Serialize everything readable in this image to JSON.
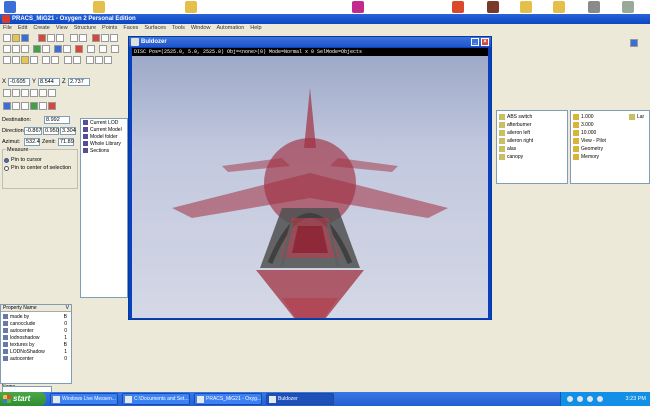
{
  "app": {
    "title": "PRACS_MiG21 - Oxygen 2 Personal Edition",
    "menu": [
      "File",
      "Edit",
      "Create",
      "View",
      "Structure",
      "Points",
      "Faces",
      "Surfaces",
      "Tools",
      "Window",
      "Automation",
      "Help"
    ]
  },
  "coords": {
    "x_label": "X",
    "x_value": "-0.605",
    "y_label": "Y",
    "y_value": "8.544",
    "z_label": "Z",
    "z_value": "2.737"
  },
  "left_panel": {
    "destination_label": "Destination:",
    "destination_value": "8.992",
    "direction_label": "Direction:",
    "direction_values": [
      "-0.867",
      "0.950",
      "3.304"
    ],
    "azimuth_label": "Azimut:",
    "azimuth_value": "532.4",
    "zenith_label": "Zenit:",
    "zenith_value": "71.89",
    "measure_label": "Measure",
    "options": [
      "Pin to cursor",
      "Pin to center of selection"
    ]
  },
  "tree": {
    "items": [
      "Current LOD",
      "Current Model",
      "Model folder",
      "Whole Library",
      "Sections"
    ]
  },
  "viewport": {
    "window_title": "Buldozer",
    "status": "DISC Pos=(2525.0, 5.0, 2525.0) Obj=<none>(0) Mode=Normal x 0 SelMode=Objects"
  },
  "list_selections": {
    "items": [
      "ABS switch",
      "afterburner",
      "aileron left",
      "aileron right",
      "alas",
      "canopy"
    ]
  },
  "list_values": {
    "items": [
      "1.000",
      "3.000",
      "10.000",
      "View - Pilot",
      "Geometry",
      "Memory"
    ],
    "extra_label": "Lar"
  },
  "properties": {
    "header_name": "Property Name",
    "header_value": "V",
    "rows": [
      {
        "name": "made by",
        "value": "B"
      },
      {
        "name": "canocclude",
        "value": "0"
      },
      {
        "name": "autocenter",
        "value": "0"
      },
      {
        "name": "lodnoshadow",
        "value": "1"
      },
      {
        "name": "textures by",
        "value": "B"
      },
      {
        "name": "LODNoShadow",
        "value": "1"
      },
      {
        "name": "autocenter",
        "value": "0"
      }
    ],
    "name_label": "Name"
  },
  "taskbar": {
    "start_label": "start",
    "tasks": [
      "Windows Live Messen...",
      "C:\\Documents and Set...",
      "PRACS_MiG21 - Oxyg...",
      "Buldozer"
    ],
    "clock": "3:23 PM"
  },
  "colors": {
    "taskbar": "#245ed0",
    "titlebar": "#0a46c4",
    "start": "#2e8e2e",
    "aircraft": "#a03040"
  }
}
